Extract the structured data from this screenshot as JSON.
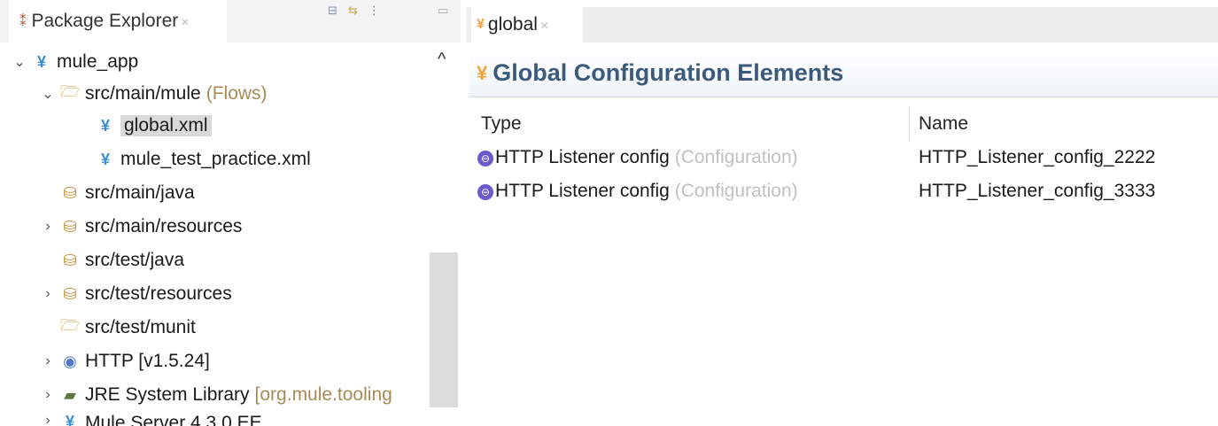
{
  "package_explorer": {
    "tab_label": "Package Explorer",
    "tab_close": "×",
    "tree": [
      {
        "twisty": "⌄",
        "icon": "mule-project-icon",
        "label": "mule_app",
        "hint": ""
      },
      {
        "twisty": "⌄",
        "icon": "folder-icon",
        "label": "src/main/mule",
        "hint": "(Flows)"
      },
      {
        "twisty": "",
        "icon": "mule-config-icon",
        "label": "global.xml",
        "hint": ""
      },
      {
        "twisty": "",
        "icon": "mule-config-icon",
        "label": "mule_test_practice.xml",
        "hint": ""
      },
      {
        "twisty": "",
        "icon": "package-folder-icon",
        "label": "src/main/java",
        "hint": ""
      },
      {
        "twisty": "›",
        "icon": "package-folder-icon",
        "label": "src/main/resources",
        "hint": ""
      },
      {
        "twisty": "",
        "icon": "package-folder-icon",
        "label": "src/test/java",
        "hint": ""
      },
      {
        "twisty": "›",
        "icon": "package-folder-icon",
        "label": "src/test/resources",
        "hint": ""
      },
      {
        "twisty": "",
        "icon": "folder-icon",
        "label": "src/test/munit",
        "hint": ""
      },
      {
        "twisty": "›",
        "icon": "http-connector-icon",
        "label": "HTTP [v1.5.24]",
        "hint": ""
      },
      {
        "twisty": "›",
        "icon": "library-icon",
        "label": "JRE System Library",
        "hint": "[org.mule.tooling"
      },
      {
        "twisty": "›",
        "icon": "mule-server-icon",
        "label": "Mule Server 4.3.0 EE",
        "hint": ""
      }
    ],
    "selected_item": "global.xml"
  },
  "editor": {
    "tab_label": "global",
    "tab_close": "×",
    "page_title": "Global Configuration Elements",
    "columns": {
      "type": "Type",
      "name": "Name"
    },
    "rows": [
      {
        "type": "HTTP Listener config",
        "kind": "(Configuration)",
        "name": "HTTP_Listener_config_2222"
      },
      {
        "type": "HTTP Listener config",
        "kind": "(Configuration)",
        "name": "HTTP_Listener_config_3333"
      }
    ]
  },
  "colors": {
    "title_blue": "#3c5a7a",
    "mule_icon": "#f0a43a",
    "hint_text": "#a88b55",
    "config_icon": "#6a5acd",
    "selection": "#d9d9d9"
  }
}
